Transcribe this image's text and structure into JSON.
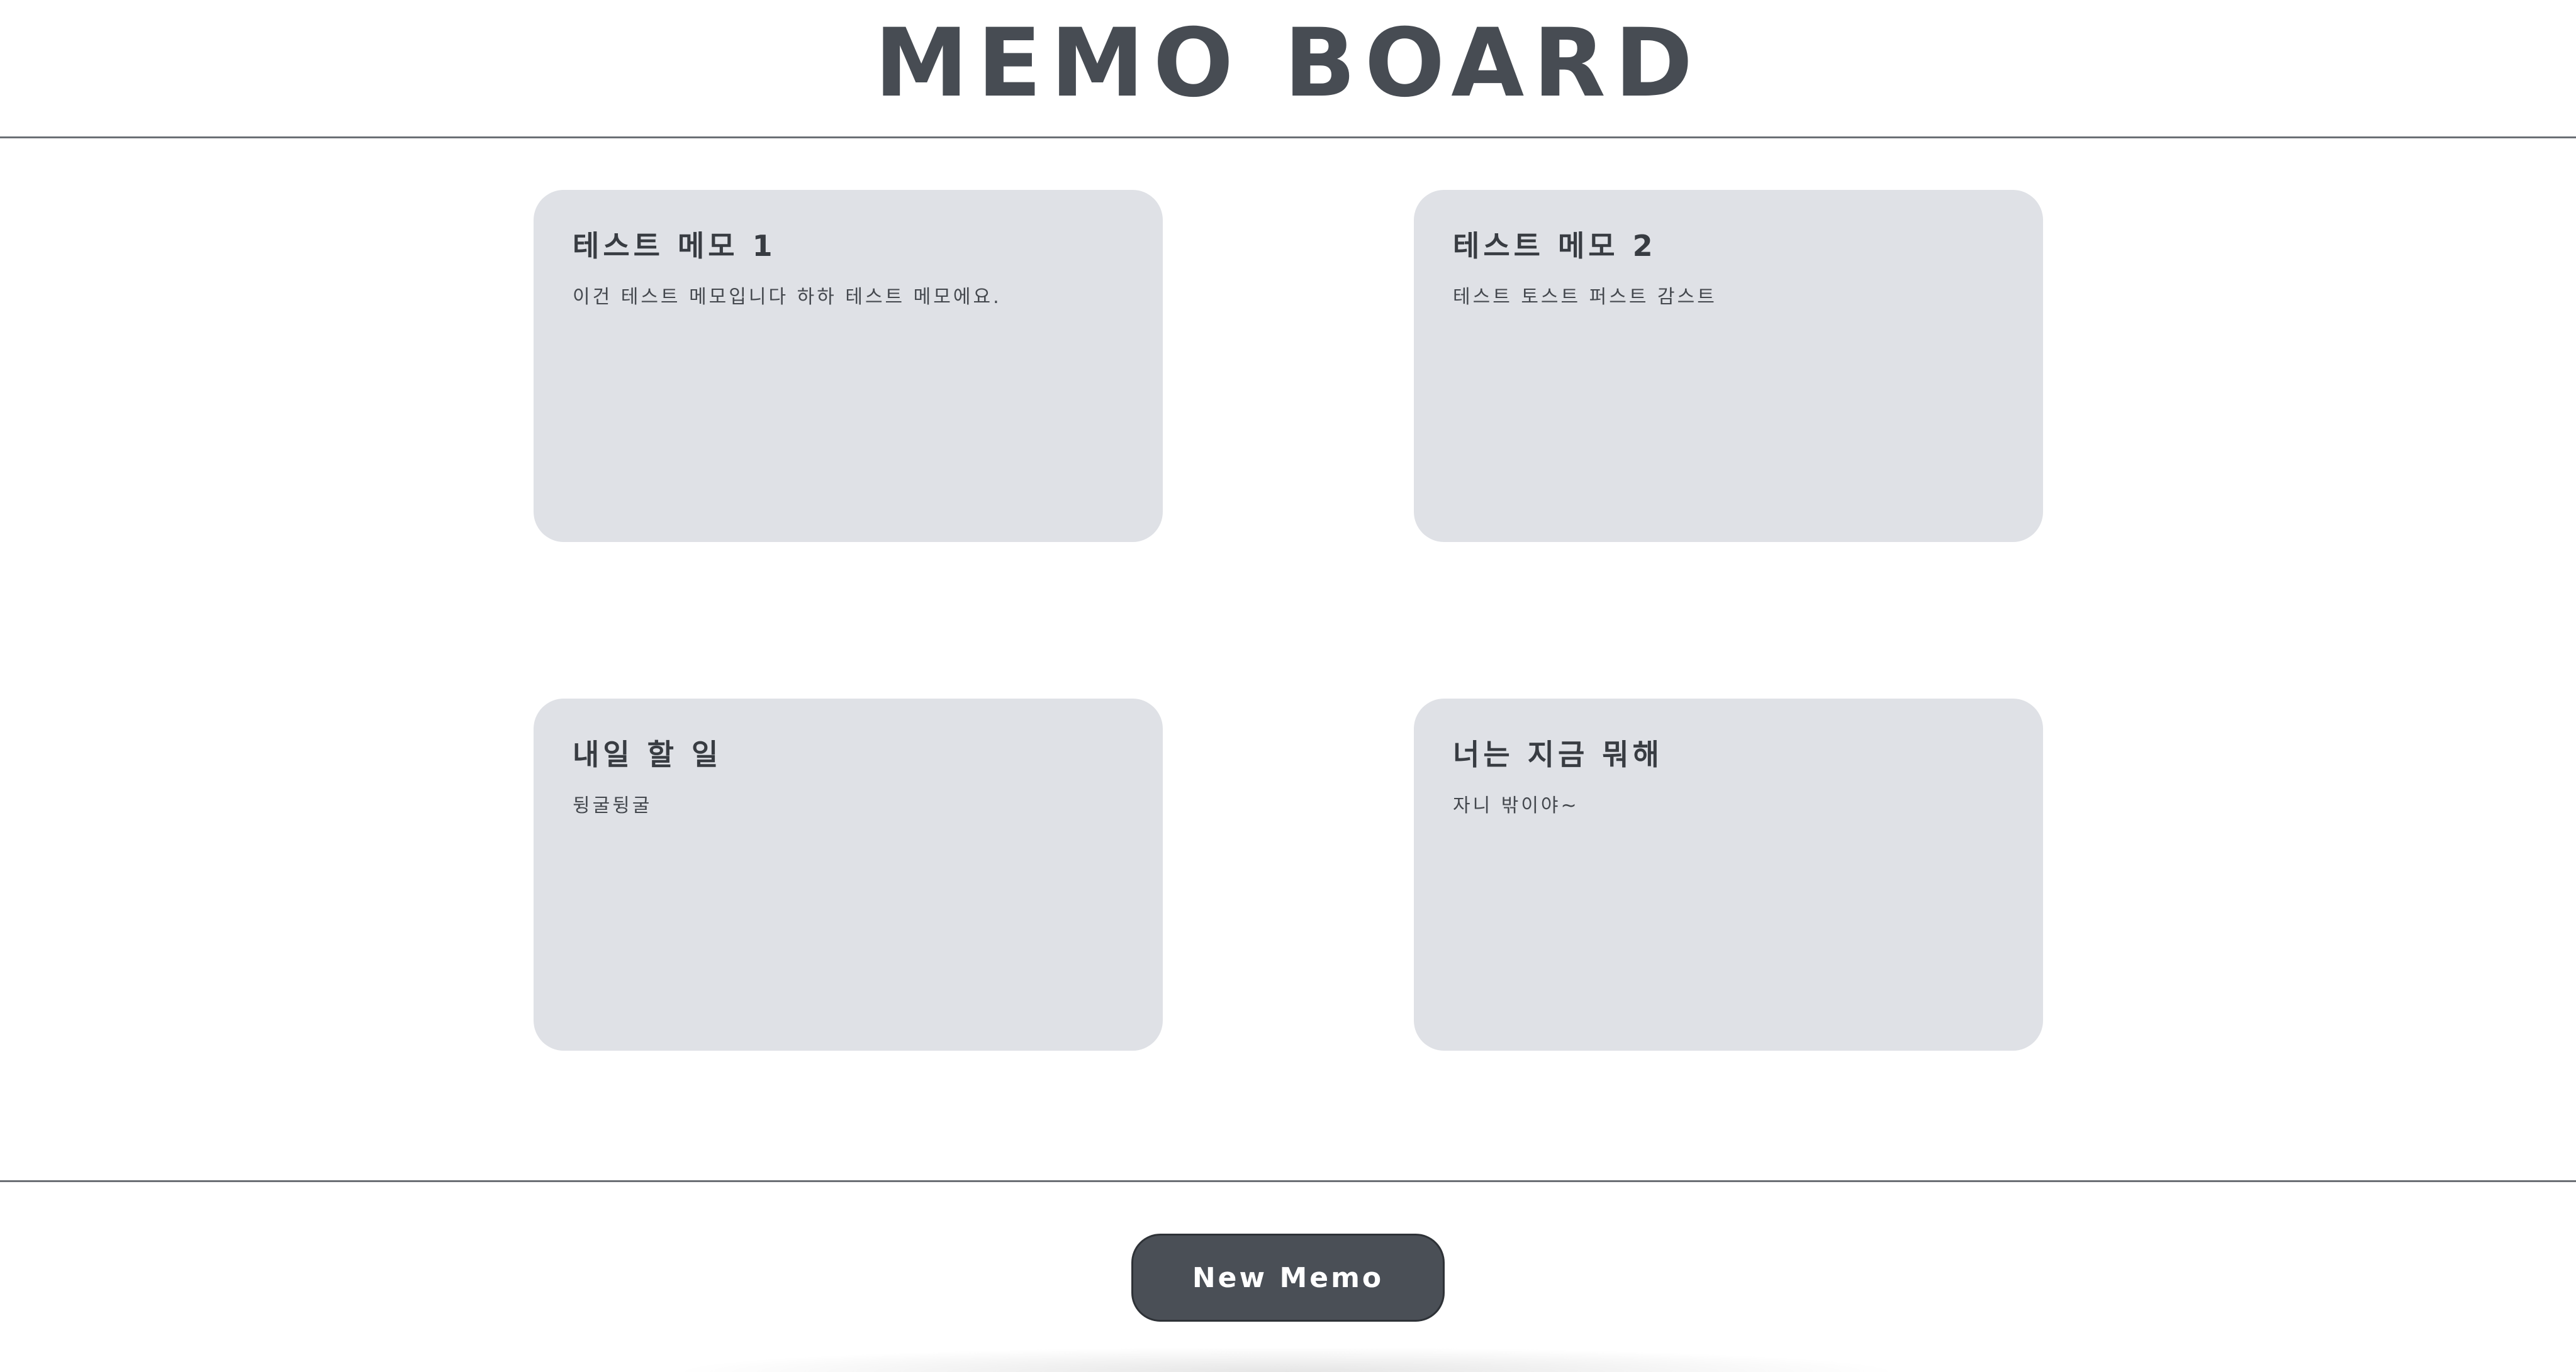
{
  "header": {
    "title": "MEMO BOARD"
  },
  "memos": [
    {
      "title": "테스트 메모 1",
      "body": "이건 테스트 메모입니다 하하 테스트 메모에요."
    },
    {
      "title": "테스트 메모 2",
      "body": "테스트 토스트 퍼스트 감스트"
    },
    {
      "title": "내일 할 일",
      "body": "뒹굴뒹굴"
    },
    {
      "title": "너는 지금 뭐해",
      "body": "자니 밖이야~"
    }
  ],
  "footer": {
    "new_memo_label": "New Memo"
  },
  "colors": {
    "memo_background": "#dfe1e6",
    "button_background": "#4a4f56",
    "text": "#3f444b"
  }
}
